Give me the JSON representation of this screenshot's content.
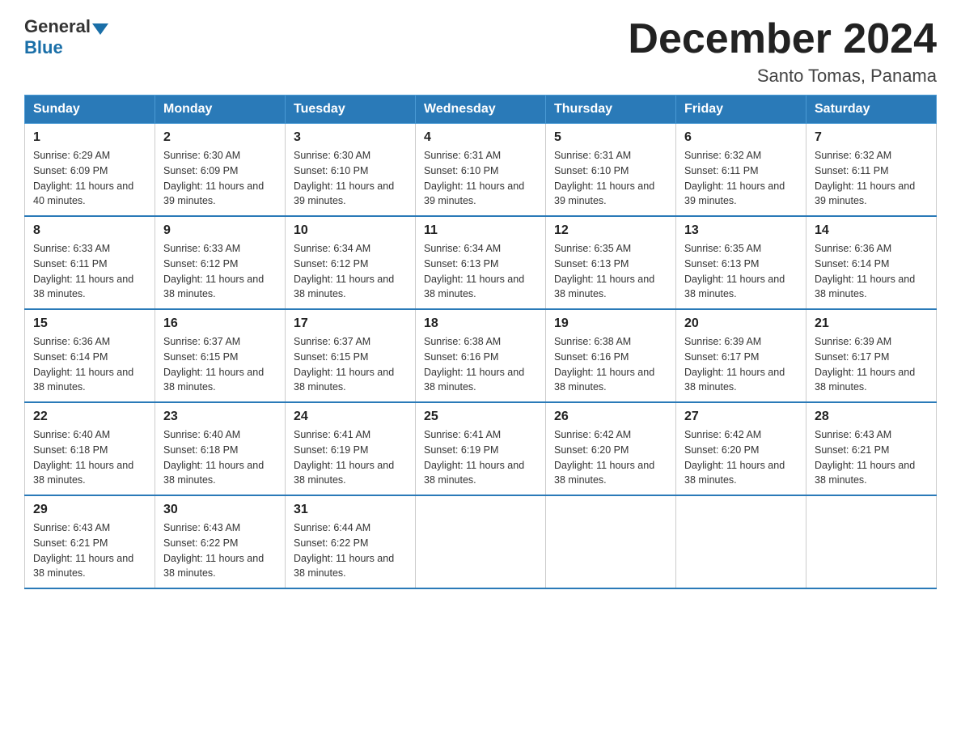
{
  "header": {
    "logo_general": "General",
    "logo_blue": "Blue",
    "month_title": "December 2024",
    "location": "Santo Tomas, Panama"
  },
  "weekdays": [
    "Sunday",
    "Monday",
    "Tuesday",
    "Wednesday",
    "Thursday",
    "Friday",
    "Saturday"
  ],
  "weeks": [
    [
      {
        "day": "1",
        "sunrise": "6:29 AM",
        "sunset": "6:09 PM",
        "daylight": "11 hours and 40 minutes."
      },
      {
        "day": "2",
        "sunrise": "6:30 AM",
        "sunset": "6:09 PM",
        "daylight": "11 hours and 39 minutes."
      },
      {
        "day": "3",
        "sunrise": "6:30 AM",
        "sunset": "6:10 PM",
        "daylight": "11 hours and 39 minutes."
      },
      {
        "day": "4",
        "sunrise": "6:31 AM",
        "sunset": "6:10 PM",
        "daylight": "11 hours and 39 minutes."
      },
      {
        "day": "5",
        "sunrise": "6:31 AM",
        "sunset": "6:10 PM",
        "daylight": "11 hours and 39 minutes."
      },
      {
        "day": "6",
        "sunrise": "6:32 AM",
        "sunset": "6:11 PM",
        "daylight": "11 hours and 39 minutes."
      },
      {
        "day": "7",
        "sunrise": "6:32 AM",
        "sunset": "6:11 PM",
        "daylight": "11 hours and 39 minutes."
      }
    ],
    [
      {
        "day": "8",
        "sunrise": "6:33 AM",
        "sunset": "6:11 PM",
        "daylight": "11 hours and 38 minutes."
      },
      {
        "day": "9",
        "sunrise": "6:33 AM",
        "sunset": "6:12 PM",
        "daylight": "11 hours and 38 minutes."
      },
      {
        "day": "10",
        "sunrise": "6:34 AM",
        "sunset": "6:12 PM",
        "daylight": "11 hours and 38 minutes."
      },
      {
        "day": "11",
        "sunrise": "6:34 AM",
        "sunset": "6:13 PM",
        "daylight": "11 hours and 38 minutes."
      },
      {
        "day": "12",
        "sunrise": "6:35 AM",
        "sunset": "6:13 PM",
        "daylight": "11 hours and 38 minutes."
      },
      {
        "day": "13",
        "sunrise": "6:35 AM",
        "sunset": "6:13 PM",
        "daylight": "11 hours and 38 minutes."
      },
      {
        "day": "14",
        "sunrise": "6:36 AM",
        "sunset": "6:14 PM",
        "daylight": "11 hours and 38 minutes."
      }
    ],
    [
      {
        "day": "15",
        "sunrise": "6:36 AM",
        "sunset": "6:14 PM",
        "daylight": "11 hours and 38 minutes."
      },
      {
        "day": "16",
        "sunrise": "6:37 AM",
        "sunset": "6:15 PM",
        "daylight": "11 hours and 38 minutes."
      },
      {
        "day": "17",
        "sunrise": "6:37 AM",
        "sunset": "6:15 PM",
        "daylight": "11 hours and 38 minutes."
      },
      {
        "day": "18",
        "sunrise": "6:38 AM",
        "sunset": "6:16 PM",
        "daylight": "11 hours and 38 minutes."
      },
      {
        "day": "19",
        "sunrise": "6:38 AM",
        "sunset": "6:16 PM",
        "daylight": "11 hours and 38 minutes."
      },
      {
        "day": "20",
        "sunrise": "6:39 AM",
        "sunset": "6:17 PM",
        "daylight": "11 hours and 38 minutes."
      },
      {
        "day": "21",
        "sunrise": "6:39 AM",
        "sunset": "6:17 PM",
        "daylight": "11 hours and 38 minutes."
      }
    ],
    [
      {
        "day": "22",
        "sunrise": "6:40 AM",
        "sunset": "6:18 PM",
        "daylight": "11 hours and 38 minutes."
      },
      {
        "day": "23",
        "sunrise": "6:40 AM",
        "sunset": "6:18 PM",
        "daylight": "11 hours and 38 minutes."
      },
      {
        "day": "24",
        "sunrise": "6:41 AM",
        "sunset": "6:19 PM",
        "daylight": "11 hours and 38 minutes."
      },
      {
        "day": "25",
        "sunrise": "6:41 AM",
        "sunset": "6:19 PM",
        "daylight": "11 hours and 38 minutes."
      },
      {
        "day": "26",
        "sunrise": "6:42 AM",
        "sunset": "6:20 PM",
        "daylight": "11 hours and 38 minutes."
      },
      {
        "day": "27",
        "sunrise": "6:42 AM",
        "sunset": "6:20 PM",
        "daylight": "11 hours and 38 minutes."
      },
      {
        "day": "28",
        "sunrise": "6:43 AM",
        "sunset": "6:21 PM",
        "daylight": "11 hours and 38 minutes."
      }
    ],
    [
      {
        "day": "29",
        "sunrise": "6:43 AM",
        "sunset": "6:21 PM",
        "daylight": "11 hours and 38 minutes."
      },
      {
        "day": "30",
        "sunrise": "6:43 AM",
        "sunset": "6:22 PM",
        "daylight": "11 hours and 38 minutes."
      },
      {
        "day": "31",
        "sunrise": "6:44 AM",
        "sunset": "6:22 PM",
        "daylight": "11 hours and 38 minutes."
      },
      null,
      null,
      null,
      null
    ]
  ],
  "sunrise_label": "Sunrise:",
  "sunset_label": "Sunset:",
  "daylight_label": "Daylight:"
}
